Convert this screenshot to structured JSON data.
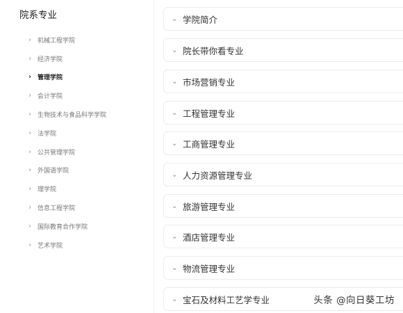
{
  "sidebar": {
    "title": "院系专业",
    "items": [
      {
        "label": "机械工程学院",
        "active": false
      },
      {
        "label": "经济学院",
        "active": false
      },
      {
        "label": "管理学院",
        "active": true
      },
      {
        "label": "会计学院",
        "active": false
      },
      {
        "label": "生物技术与食品科学学院",
        "active": false
      },
      {
        "label": "法学院",
        "active": false
      },
      {
        "label": "公共管理学院",
        "active": false
      },
      {
        "label": "外国语学院",
        "active": false
      },
      {
        "label": "理学院",
        "active": false
      },
      {
        "label": "信息工程学院",
        "active": false
      },
      {
        "label": "国际教育合作学院",
        "active": false
      },
      {
        "label": "艺术学院",
        "active": false
      }
    ]
  },
  "main": {
    "panels": [
      {
        "label": "学院简介"
      },
      {
        "label": "院长带你看专业"
      },
      {
        "label": "市场营销专业"
      },
      {
        "label": "工程管理专业"
      },
      {
        "label": "工商管理专业"
      },
      {
        "label": "人力资源管理专业"
      },
      {
        "label": "旅游管理专业"
      },
      {
        "label": "酒店管理专业"
      },
      {
        "label": "物流管理专业"
      },
      {
        "label": "宝石及材料工艺学专业"
      }
    ]
  },
  "watermark": "头条 @向日葵工坊"
}
